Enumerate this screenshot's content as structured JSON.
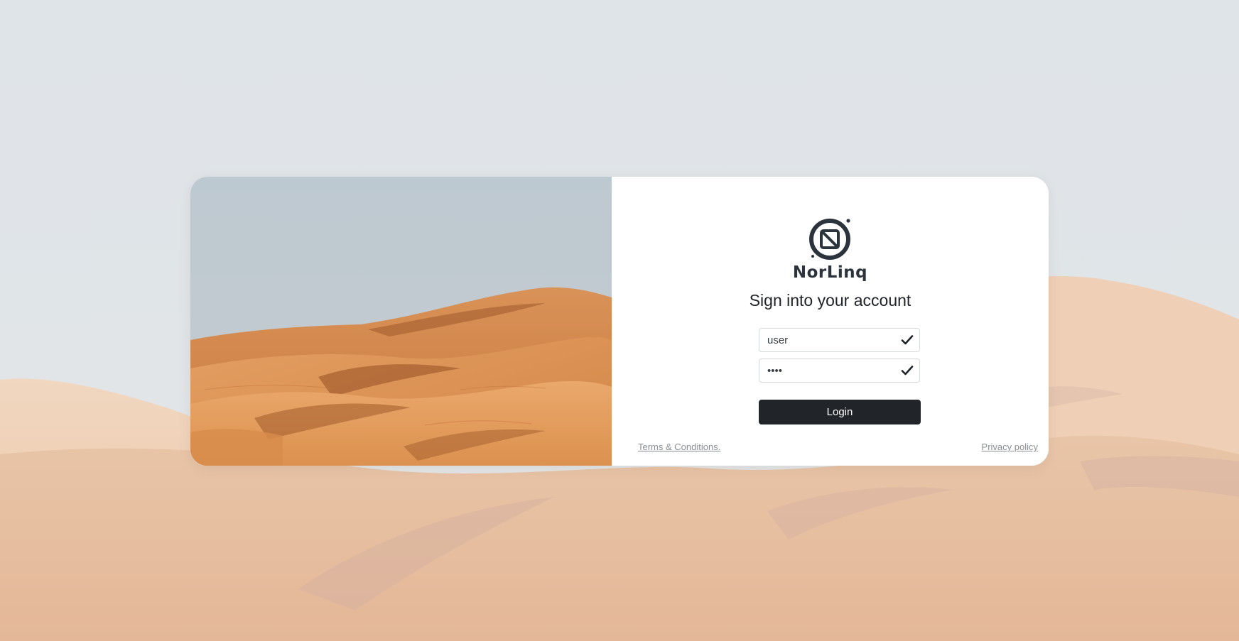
{
  "brand": {
    "name": "NorLinq",
    "logo_icon": "norlinq-logo-icon",
    "color": "#2b333d"
  },
  "form": {
    "title": "Sign into your account",
    "username": {
      "value": "user",
      "valid_icon": "check-icon"
    },
    "password": {
      "value": "user",
      "valid_icon": "check-icon"
    },
    "login_label": "Login",
    "login_color": "#212529"
  },
  "footer": {
    "terms_label": "Terms & Conditions.",
    "privacy_label": "Privacy policy"
  },
  "side_image": {
    "subject": "desert-dunes-image"
  }
}
